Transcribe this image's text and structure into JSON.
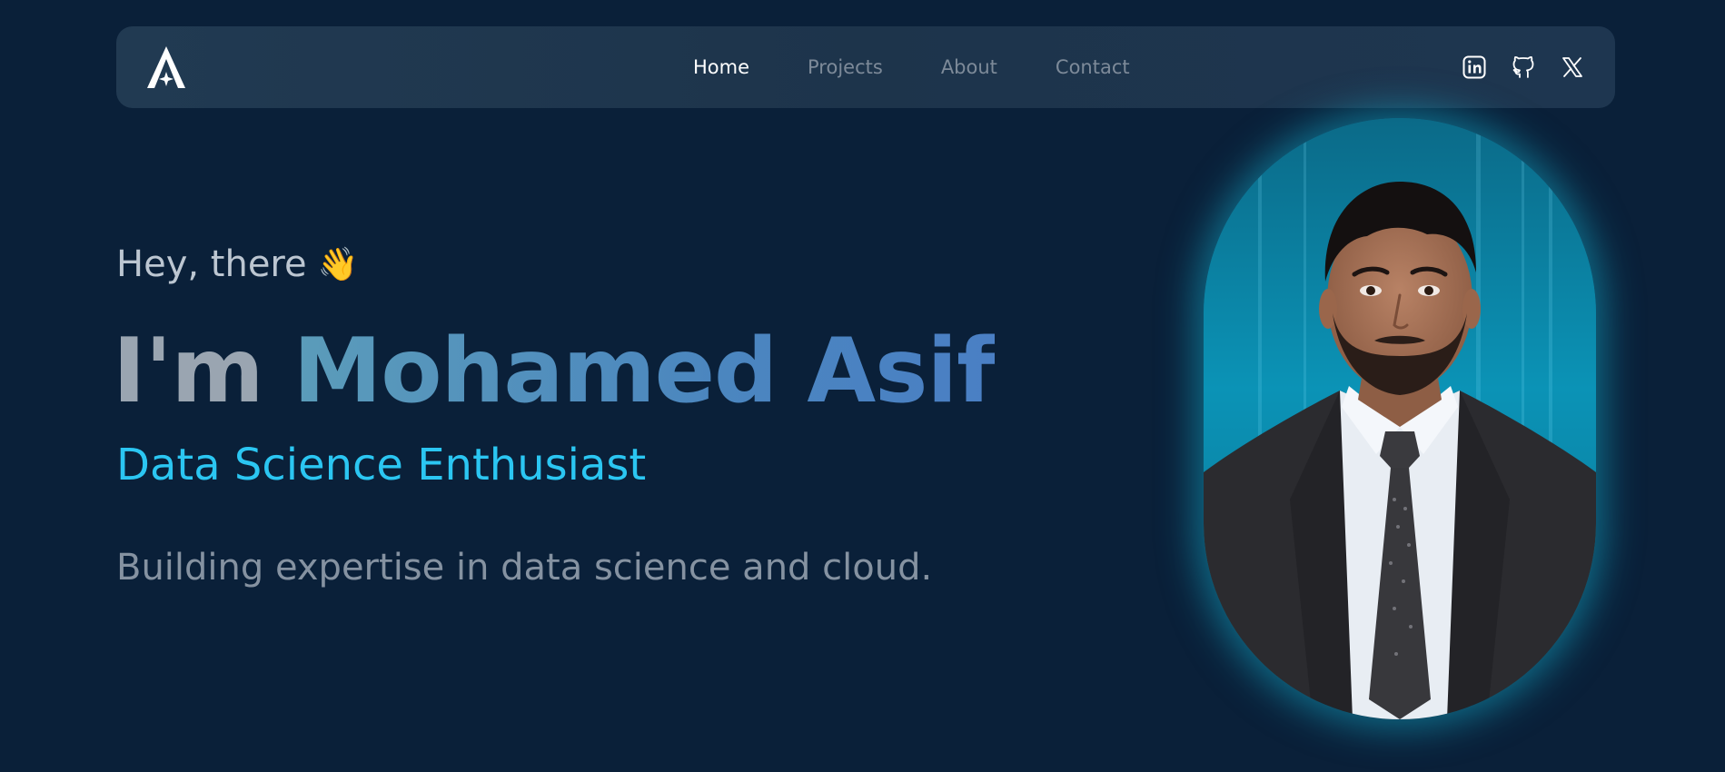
{
  "nav": {
    "logo": "logo-icon",
    "links": [
      {
        "label": "Home",
        "active": true
      },
      {
        "label": "Projects",
        "active": false
      },
      {
        "label": "About",
        "active": false
      },
      {
        "label": "Contact",
        "active": false
      }
    ],
    "socials": [
      "linkedin-icon",
      "github-icon",
      "x-icon"
    ]
  },
  "hero": {
    "greeting": "Hey, there",
    "wave_emoji": "👋",
    "headline_prefix": "I'm",
    "name": "Mohamed Asif",
    "role": "Data Science Enthusiast",
    "tagline": "Building expertise in data science and cloud."
  },
  "colors": {
    "background": "#0a2039",
    "navbar": "#1f374f",
    "accent": "#2bc6f2",
    "name_gradient_start": "#5b9cba",
    "name_gradient_end": "#4a7fc4",
    "portrait_glow": "#14aac8"
  }
}
